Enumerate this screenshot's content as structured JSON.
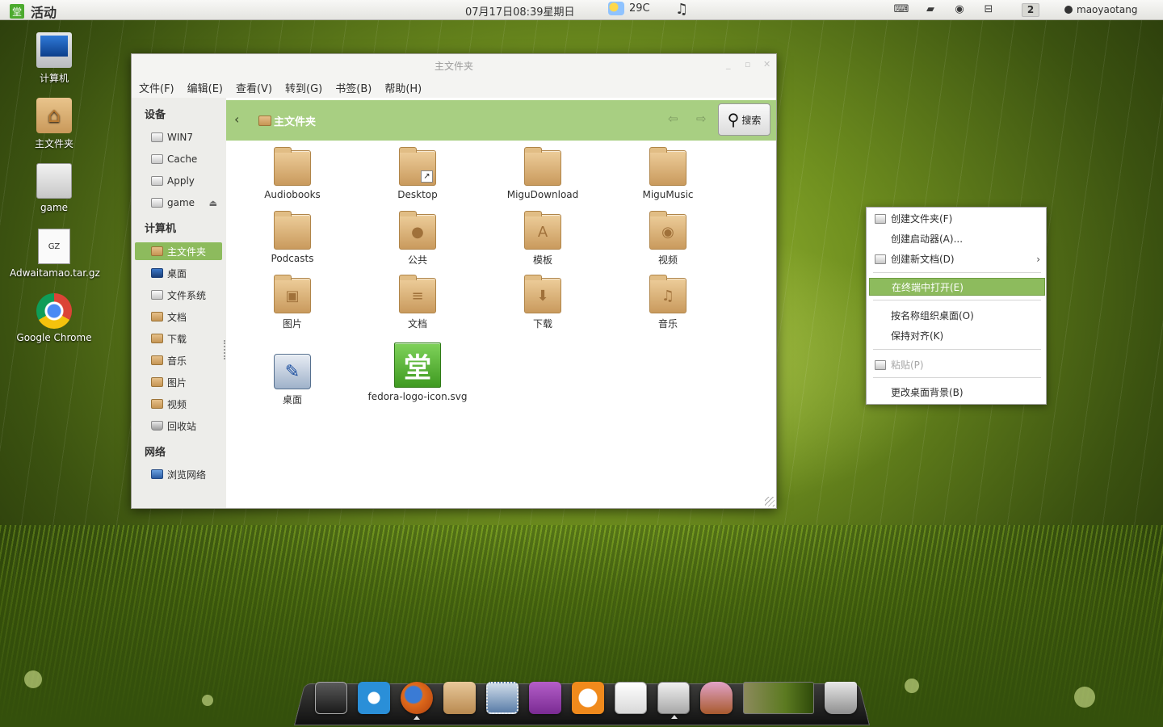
{
  "top_panel": {
    "activities_logo": "堂",
    "activities_label": "活动",
    "clock": "07月17日08:39星期日",
    "weather_temp": "29C",
    "music_icon": "♫",
    "workspace_number": "2",
    "username": "maoyaotang",
    "tray_icons": [
      "keyboard-icon",
      "folder-icon",
      "disc-icon",
      "network-icon"
    ]
  },
  "desktop_icons": [
    {
      "name": "computer",
      "label": "计算机",
      "icon": "computer-icon"
    },
    {
      "name": "home",
      "label": "主文件夹",
      "icon": "home-folder-icon"
    },
    {
      "name": "game",
      "label": "game",
      "icon": "drive-icon"
    },
    {
      "name": "adwaitamao",
      "label": "Adwaitamao.tar.gz",
      "icon": "archive-icon",
      "badge": "GZ"
    },
    {
      "name": "chrome",
      "label": "Google Chrome",
      "icon": "chrome-icon"
    }
  ],
  "window": {
    "title": "主文件夹",
    "controls": [
      "_",
      "▫",
      "✕"
    ],
    "menu": [
      "文件(F)",
      "编辑(E)",
      "查看(V)",
      "转到(G)",
      "书签(B)",
      "帮助(H)"
    ],
    "sidebar": {
      "devices_heading": "设备",
      "devices": [
        "WIN7",
        "Cache",
        "Apply",
        "game"
      ],
      "computer_heading": "计算机",
      "places": [
        "主文件夹",
        "桌面",
        "文件系统",
        "文档",
        "下载",
        "音乐",
        "图片",
        "视频",
        "回收站"
      ],
      "network_heading": "网络",
      "network": [
        "浏览网络"
      ],
      "active_place": "主文件夹"
    },
    "pathbar": {
      "back_icon": "‹",
      "crumb": "主文件夹",
      "prev_icon": "⇦",
      "next_icon": "⇨",
      "search_label": "搜索"
    },
    "files": [
      {
        "name": "Audiobooks",
        "glyph": ""
      },
      {
        "name": "Desktop",
        "glyph": "",
        "shortcut": "↗"
      },
      {
        "name": "MiguDownload",
        "glyph": ""
      },
      {
        "name": "MiguMusic",
        "glyph": ""
      },
      {
        "name": "Podcasts",
        "glyph": ""
      },
      {
        "name": "公共",
        "glyph": "●"
      },
      {
        "name": "模板",
        "glyph": "A"
      },
      {
        "name": "视频",
        "glyph": "◉"
      },
      {
        "name": "图片",
        "glyph": "▣"
      },
      {
        "name": "文档",
        "glyph": "≡"
      },
      {
        "name": "下载",
        "glyph": "⬇"
      },
      {
        "name": "音乐",
        "glyph": "♫"
      },
      {
        "name": "桌面",
        "glyph": "✎"
      },
      {
        "name": "fedora-logo-icon.svg",
        "glyph": "堂"
      }
    ]
  },
  "context_menu": {
    "items": [
      {
        "label": "创建文件夹(F)"
      },
      {
        "label": "创建启动器(A)..."
      },
      {
        "label": "创建新文档(D)",
        "submenu_arrow": "›"
      },
      {
        "label": "在终端中打开(E)",
        "highlighted": true
      },
      {
        "label": "按名称组织桌面(O)"
      },
      {
        "label": "保持对齐(K)"
      },
      {
        "label": "粘贴(P)",
        "disabled": true
      },
      {
        "label": "更改桌面背景(B)"
      }
    ]
  },
  "dock": {
    "items": [
      "system-monitor-icon",
      "bing-icon",
      "firefox-icon",
      "package-icon",
      "mail-stamp-icon",
      "chat-icon",
      "game-app-icon",
      "blank-document-icon",
      "file-cabinet-icon",
      "gift-basket-icon",
      "window-thumbnail",
      "trash-can-icon"
    ]
  },
  "colors": {
    "accent_green": "#8dbb5d",
    "pathbar_green": "#a8cf82",
    "folder_tan": "#d9ad6f",
    "panel_bg": "#ececea"
  }
}
